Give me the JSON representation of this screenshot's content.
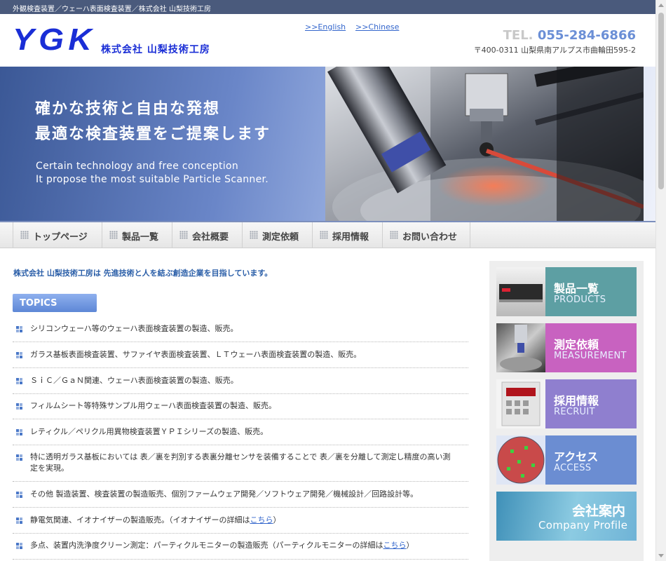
{
  "topbar": {
    "text": "外観検査装置／ウェーハ表面検査装置／株式会社 山梨技術工房"
  },
  "header": {
    "logo": "YGK",
    "company": "株式会社 山梨技術工房",
    "lang_en": ">>English",
    "lang_zh": ">>Chinese",
    "tel_label": "TEL.",
    "tel_number": "055-284-6866",
    "address": "〒400-0311 山梨県南アルプス市曲輪田595-2"
  },
  "hero": {
    "jp_line1": "確かな技術と自由な発想",
    "jp_line2": "最適な検査装置をご提案します",
    "en_line1": "Certain technology and free conception",
    "en_line2": "It propose the most suitable Particle Scanner."
  },
  "nav": [
    {
      "label": "トップページ"
    },
    {
      "label": "製品一覧"
    },
    {
      "label": "会社概要"
    },
    {
      "label": "測定依頼"
    },
    {
      "label": "採用情報"
    },
    {
      "label": "お問い合わせ"
    }
  ],
  "intro": "株式会社 山梨技術工房は 先進技術と人を結ぶ創造企業を目指しています。",
  "topics": {
    "heading": "TOPICS",
    "items": [
      {
        "text": "シリコンウェーハ等のウェーハ表面検査装置の製造、販売。"
      },
      {
        "text": "ガラス基板表面検査装置、サファイヤ表面検査装置、ＬＴウェーハ表面検査装置の製造、販売。"
      },
      {
        "text": "ＳｉＣ／ＧａＮ関連、ウェーハ表面検査装置の製造、販売。"
      },
      {
        "text": "フィルムシート等特殊サンプル用ウェーハ表面検査装置の製造、販売。"
      },
      {
        "text": "レティクル／ペリクル用異物検査装置ＹＰＩシリーズの製造、販売。"
      },
      {
        "text": "特に透明ガラス基板においては 表／裏を判別する表裏分離センサを装備することで 表／裏を分離して測定し精度の高い測定を実現。"
      },
      {
        "text": "その他 製造装置、検査装置の製造販売、個別ファームウェア開発／ソフトウェア開発／機械設計／回路設計等。"
      },
      {
        "text": "静電気関連、イオナイザーの製造販売。（イオナイザーの詳細は",
        "link": "こちら",
        "after": "）"
      },
      {
        "text": "多点、装置内洗浄度クリーン測定：パーティクルモニターの製造販売（パーティクルモニターの詳細は",
        "link": "こちら",
        "after": "）"
      }
    ]
  },
  "sidebar": {
    "products": {
      "jp": "製品一覧",
      "en": "PRODUCTS"
    },
    "measurement": {
      "jp": "測定依頼",
      "en": "MEASUREMENT"
    },
    "recruit": {
      "jp": "採用情報",
      "en": "RECRUIT"
    },
    "access": {
      "jp": "アクセス",
      "en": "ACCESS"
    },
    "company": {
      "jp": "会社案内",
      "en": "Company Profile"
    }
  },
  "colors": {
    "brand_blue": "#1a2ed6",
    "products": "#5d9fa3",
    "measurement": "#c862c0",
    "recruit": "#8f7fcf",
    "access": "#6b8dd2"
  }
}
